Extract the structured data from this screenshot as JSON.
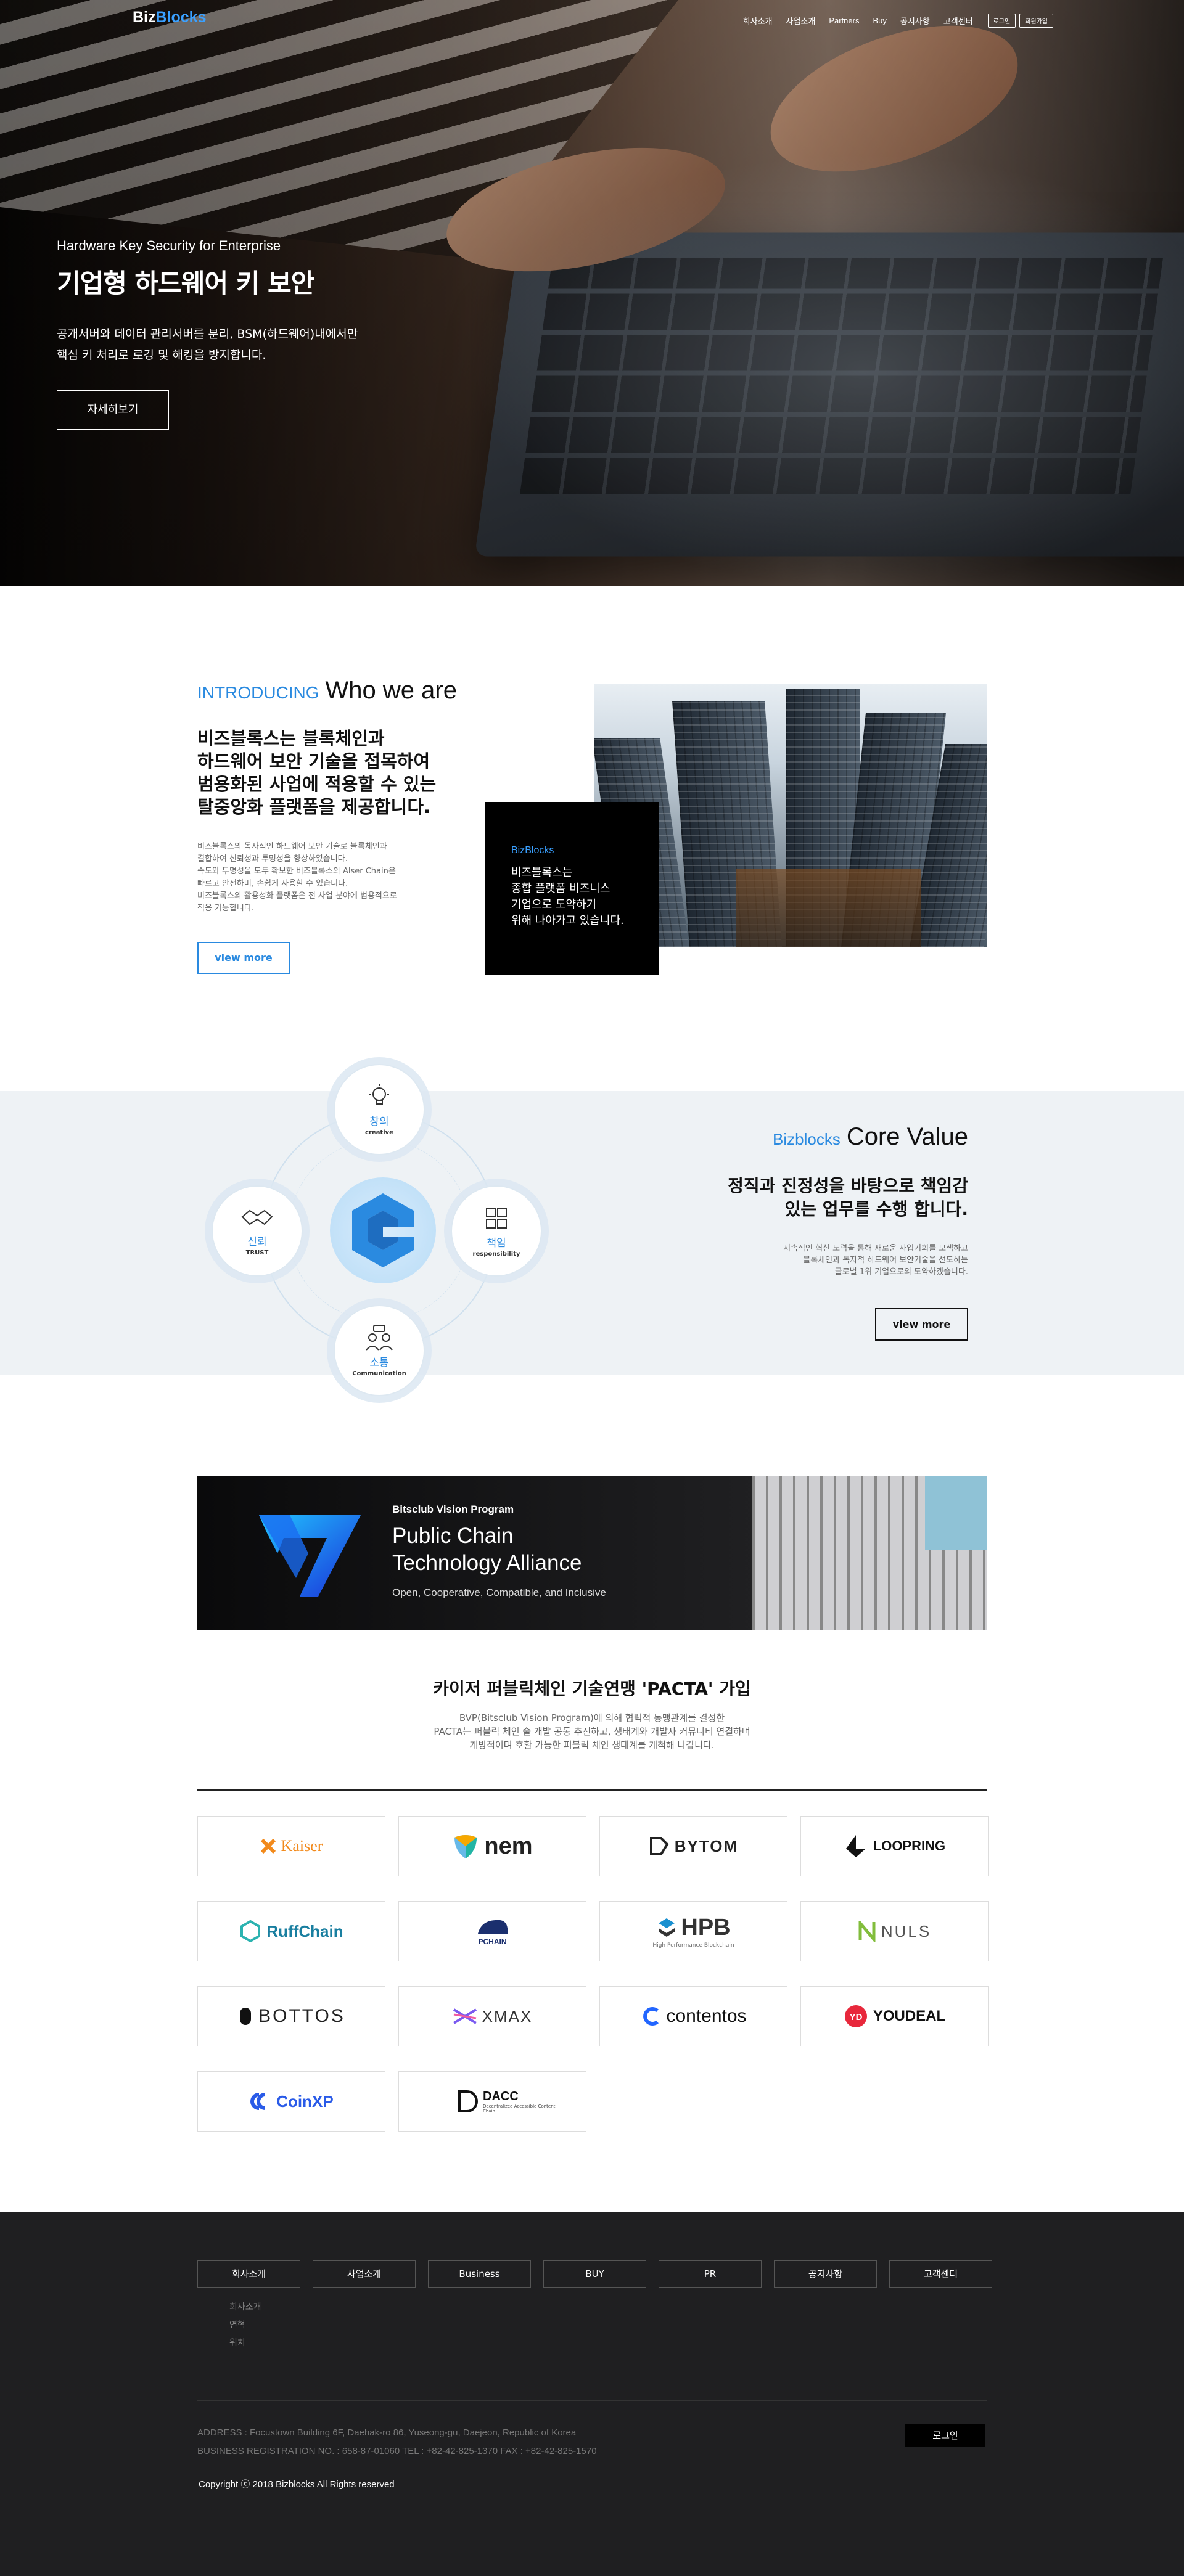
{
  "header": {
    "logo_a": "Biz",
    "logo_b": "Blocks",
    "menu": [
      "회사소개",
      "사업소개",
      "Partners",
      "Buy",
      "공지사항",
      "고객센터"
    ],
    "util": [
      "로그인",
      "회원가입"
    ]
  },
  "hero": {
    "subtitle": "Hardware Key Security for Enterprise",
    "title": "기업형 하드웨어 키 보안",
    "desc_line1": "공개서버와 데이터 관리서버를 분리, BSM(하드웨어)내에서만",
    "desc_line2": "핵심 키 처리로 로깅 및 해킹을 방지합니다.",
    "button": "자세히보기"
  },
  "intro": {
    "heading_accent": "INTRODUCING",
    "heading": "Who we are",
    "lead": [
      "비즈블록스는 블록체인과",
      "하드웨어 보안 기술을 접목하여",
      "범용화된 사업에 적용할 수 있는",
      "탈중앙화 플랫폼을 제공합니다."
    ],
    "body": [
      "비즈블록스의 독자적인 하드웨어 보안 기술로 블록체인과",
      "결합하여 신뢰성과 투명성을 향상하였습니다.",
      "속도와 투명성을 모두 확보한 비즈블록스의 Alser Chain은",
      "빠르고 안전하며, 손쉽게 사용할 수 있습니다.",
      "비즈블록스의 활용성화 플랫폼은 전 사업 분야에 범용적으로",
      "적용 가능합니다."
    ],
    "button": "view more",
    "box_brand": "BizBlocks",
    "box_text": [
      "비즈블록스는",
      "종합 플랫폼 비즈니스",
      "기업으로 도약하기",
      "위해 나아가고 있습니다."
    ]
  },
  "core": {
    "heading_accent": "Bizblocks",
    "heading": "Core Value",
    "lead": [
      "정직과 진정성을 바탕으로 책임감",
      "있는 업무를 수행 합니다."
    ],
    "body": [
      "지속적인 혁신 노력을 통해 새로운 사업기회를 모색하고",
      "블록체인과 독자적 하드웨어 보안기술을 선도하는",
      "글로벌 1위 기업으로의 도약하겠습니다."
    ],
    "button": "view more",
    "values": [
      {
        "ko": "창의",
        "en": "creative"
      },
      {
        "ko": "신뢰",
        "en": "TRUST"
      },
      {
        "ko": "책임",
        "en": "responsibility"
      },
      {
        "ko": "소통",
        "en": "Communication"
      }
    ]
  },
  "pacta": {
    "banner_small": "Bitsclub Vision Program",
    "banner_big1": "Public Chain",
    "banner_big2": "Technology Alliance",
    "banner_tag": "Open, Cooperative, Compatible, and Inclusive",
    "title": "카이저 퍼블릭체인 기술연맹 'PACTA' 가입",
    "desc": [
      "BVP(Bitsclub Vision Program)에 의해 협력적 동맹관계를 결성한",
      "PACTA는 퍼블릭 체인 술 개발 공동 추진하고, 생태계와 개발자 커뮤니티 연결하며",
      "개방적이며 호환 가능한 퍼블릭 체인 생태계를 개척해 나갑니다."
    ],
    "partners": [
      "Kaiser",
      "nem",
      "BYTOM",
      "LOOPRING",
      "RuffChain",
      "PCHAIN",
      "HPB",
      "NULS",
      "BOTTOS",
      "XMAX",
      "contentos",
      "YOUDEAL",
      "CoinXP",
      "DACC"
    ],
    "hpb_sub": "High Performance Blockchain",
    "dacc_sub": "Decentralized Accessible Content Chain"
  },
  "footer": {
    "nav": [
      "회사소개",
      "사업소개",
      "Business",
      "BUY",
      "PR",
      "공지사항",
      "고객센터"
    ],
    "sub": [
      "회사소개",
      "연혁",
      "위치"
    ],
    "address": "ADDRESS : Focustown Building 6F, Daehak-ro 86, Yuseong-gu, Daejeon, Republic of Korea",
    "registration": "BUSINESS REGISTRATION NO. : 658-87-01060 TEL : +82-42-825-1370 FAX : +82-42-825-1570",
    "copyright": "Copyright ⓒ 2018 Bizblocks All Rights reserved",
    "login": "로그인"
  },
  "colors": {
    "accent": "#2a8ae0",
    "footer_bg": "#1f1f21"
  }
}
